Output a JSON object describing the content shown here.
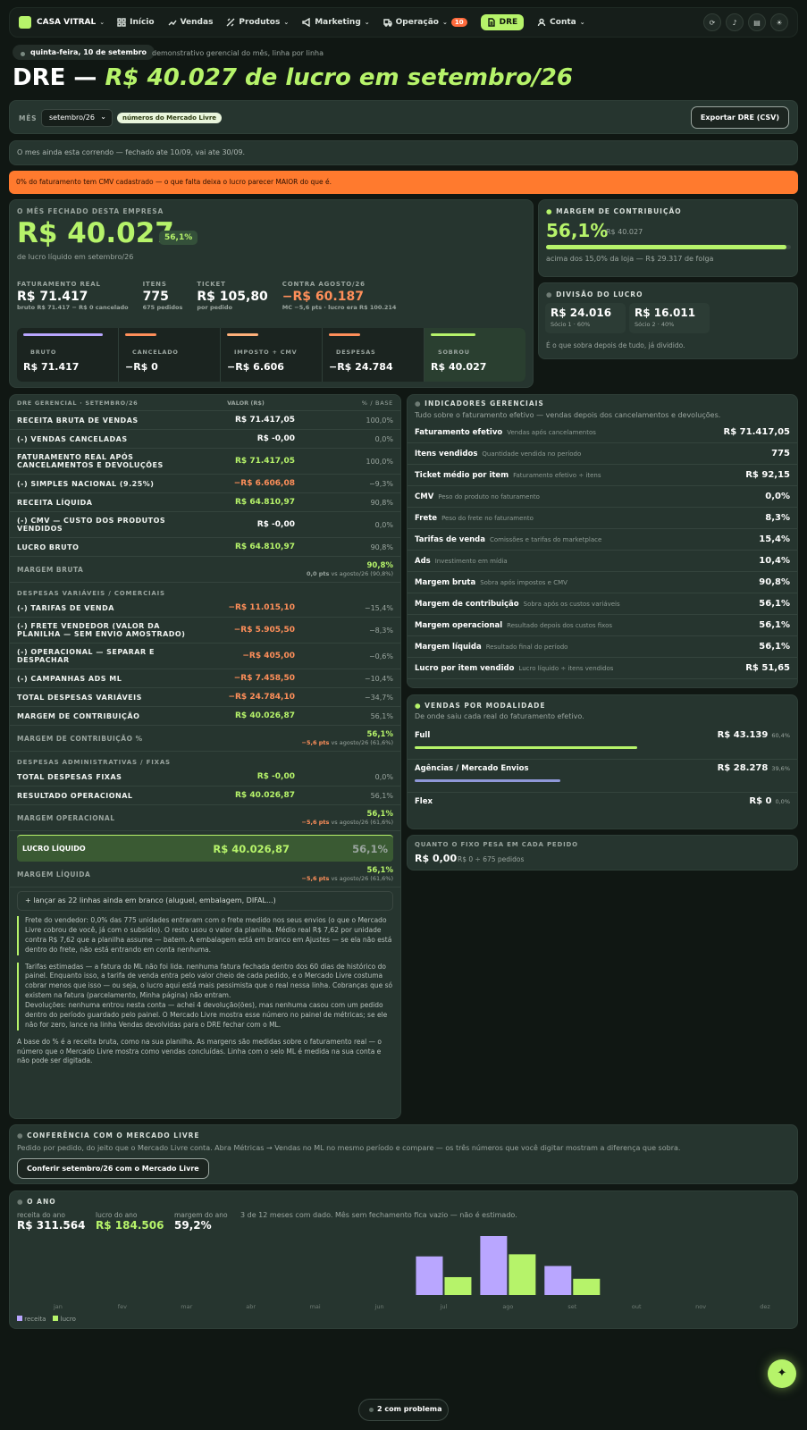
{
  "nav": {
    "brand": "CASA VITRAL",
    "items": [
      {
        "label": "Início",
        "icon": "home-icon"
      },
      {
        "label": "Vendas",
        "icon": "trend-icon"
      },
      {
        "label": "Produtos",
        "icon": "tag-icon"
      },
      {
        "label": "Marketing",
        "icon": "megaphone-icon"
      },
      {
        "label": "Operação",
        "icon": "truck-icon",
        "badge": "10"
      },
      {
        "label": "DRE",
        "icon": "document-icon"
      },
      {
        "label": "Conta",
        "icon": "user-icon"
      }
    ]
  },
  "header": {
    "date": "quinta-feira, 10 de setembro",
    "subtitle": "demonstrativo gerencial do mês, linha por linha",
    "title_a": "DRE —",
    "title_b": "R$ 40.027 de lucro em setembro/26"
  },
  "filter": {
    "label": "MÊS",
    "month": "setembro/26",
    "tag": "números do Mercado Livre",
    "export": "Exportar DRE (CSV)"
  },
  "info": "O mes ainda esta correndo — fechado ate 10/09, vai ate 30/09.",
  "warning": "0% do faturamento tem CMV cadastrado — o que falta deixa o lucro parecer MAIOR do que é.",
  "summary": {
    "label": "O MÊS FECHADO DESTA EMPRESA",
    "value": "R$ 40.027",
    "margin": "56,1%",
    "caption": "de lucro líquido em setembro/26",
    "kpis": [
      {
        "l": "FATURAMENTO REAL",
        "v": "R$ 71.417",
        "s": "bruto R$ 71.417 − R$ 0 cancelado"
      },
      {
        "l": "ITENS",
        "v": "775",
        "s": "675 pedidos"
      },
      {
        "l": "TICKET",
        "v": "R$ 105,80",
        "s": "por pedido"
      },
      {
        "l": "CONTRA AGOSTO/26",
        "v": "−R$ 60.187",
        "s": "MC −5,6 pts · lucro era R$ 100.214"
      }
    ],
    "flow": [
      {
        "l": "BRUTO",
        "v": "R$ 71.417"
      },
      {
        "l": "CANCELADO",
        "v": "−R$ 0"
      },
      {
        "l": "IMPOSTO + CMV",
        "v": "−R$ 6.606"
      },
      {
        "l": "DESPESAS",
        "v": "−R$ 24.784"
      },
      {
        "l": "SOBROU",
        "v": "R$ 40.027"
      }
    ]
  },
  "mc": {
    "label": "MARGEM DE CONTRIBUIÇÃO",
    "value": "56,1%",
    "abs": "R$ 40.027",
    "bar": 0.98,
    "note": "acima dos 15,0% da loja — R$ 29.317 de folga"
  },
  "div": {
    "label": "DIVISÃO DO LUCRO",
    "a": "R$ 24.016",
    "as": "Sócio 1 · 60%",
    "b": "R$ 16.011",
    "bs": "Sócio 2 · 40%",
    "note": "É o que sobra depois de tudo, já dividido."
  },
  "dre": {
    "head": [
      "DRE GERENCIAL · SETEMBRO/26",
      "VALOR (R$)",
      "% / BASE"
    ],
    "a": [
      {
        "n": "RECEITA BRUTA DE VENDAS",
        "ml": true,
        "v": "R$ 71.417,05",
        "p": "100,0%",
        "c": "white"
      },
      {
        "n": "(-) VENDAS CANCELADAS",
        "ml": true,
        "v": "R$ -0,00",
        "p": "0,0%",
        "c": "white"
      },
      {
        "n": "FATURAMENTO REAL APÓS CANCELAMENTOS E DEVOLUÇÕES",
        "v": "R$ 71.417,05",
        "p": "100,0%",
        "c": "green"
      },
      {
        "n": "(-) SIMPLES NACIONAL (9.25%)",
        "ml": true,
        "v": "−R$ 6.606,08",
        "p": "−9,3%",
        "c": "orange"
      },
      {
        "n": "RECEITA LÍQUIDA",
        "v": "R$ 64.810,97",
        "p": "90,8%",
        "c": "green"
      },
      {
        "n": "(-) CMV — CUSTO DOS PRODUTOS VENDIDOS",
        "ml": true,
        "v": "R$ -0,00",
        "p": "0,0%",
        "c": "white"
      },
      {
        "n": "LUCRO BRUTO",
        "v": "R$ 64.810,97",
        "p": "90,8%",
        "c": "green"
      }
    ],
    "mb": {
      "n": "MARGEM BRUTA",
      "v": "90,8%",
      "d": "0,0 pts",
      "r": "vs agosto/26 (90,8%)"
    },
    "sec_var": "DESPESAS VARIÁVEIS / COMERCIAIS",
    "b": [
      {
        "n": "(-) TARIFAS DE VENDA",
        "ml": true,
        "v": "−R$ 11.015,10",
        "p": "−15,4%",
        "c": "orange"
      },
      {
        "n": "(-) FRETE VENDEDOR (VALOR DA PLANILHA — SEM ENVIO AMOSTRADO)",
        "ml": true,
        "v": "−R$ 5.905,50",
        "p": "−8,3%",
        "c": "orange"
      },
      {
        "n": "(-) OPERACIONAL — SEPARAR E DESPACHAR",
        "ml": true,
        "v": "−R$ 405,00",
        "p": "−0,6%",
        "c": "orange"
      },
      {
        "n": "(-) CAMPANHAS ADS ML",
        "ml": true,
        "v": "−R$ 7.458,50",
        "p": "−10,4%",
        "c": "orange"
      },
      {
        "n": "TOTAL DESPESAS VARIÁVEIS",
        "v": "−R$ 24.784,10",
        "p": "−34,7%",
        "c": "orange"
      },
      {
        "n": "MARGEM DE CONTRIBUIÇÃO",
        "v": "R$ 40.026,87",
        "p": "56,1%",
        "c": "green"
      }
    ],
    "mcp": {
      "n": "MARGEM DE CONTRIBUIÇÃO %",
      "v": "56,1%",
      "d": "−5,6 pts",
      "r": "vs agosto/26 (61,6%)"
    },
    "sec_fix": "DESPESAS ADMINISTRATIVAS / FIXAS",
    "c": [
      {
        "n": "TOTAL DESPESAS FIXAS",
        "v": "R$ -0,00",
        "p": "0,0%",
        "c": "green"
      },
      {
        "n": "RESULTADO OPERACIONAL",
        "v": "R$ 40.026,87",
        "p": "56,1%",
        "c": "green"
      }
    ],
    "mo": {
      "n": "MARGEM OPERACIONAL",
      "v": "56,1%",
      "d": "−5,6 pts",
      "r": "vs agosto/26 (61,6%)"
    },
    "ll": {
      "n": "LUCRO LÍQUIDO",
      "v": "R$ 40.026,87",
      "p": "56,1%"
    },
    "ml": {
      "n": "MARGEM LÍQUIDA",
      "v": "56,1%",
      "d": "−5,6 pts",
      "r": "vs agosto/26 (61,6%)"
    },
    "launch": "+ lançar as 22 linhas ainda em branco (aluguel, embalagem, DIFAL...)",
    "note1": "Frete do vendedor: 0,0% das 775 unidades entraram com o frete medido nos seus envios (o que o Mercado Livre cobrou de você, já com o subsídio). O resto usou o valor da planilha. Médio real R$ 7,62 por unidade contra R$ 7,62 que a planilha assume — batem. A embalagem está em branco em Ajustes — se ela não está dentro do frete, não está entrando em conta nenhuma.",
    "note2": "Tarifas estimadas — a fatura do ML não foi lida. nenhuma fatura fechada dentro dos 60 dias de histórico do painel. Enquanto isso, a tarifa de venda entra pelo valor cheio de cada pedido, e o Mercado Livre costuma cobrar menos que isso — ou seja, o lucro aqui está mais pessimista que o real nessa linha. Cobranças que só existem na fatura (parcelamento, Minha página) não entram.",
    "note3": "Devoluções: nenhuma entrou nesta conta — achei 4 devolução(ões), mas nenhuma casou com um pedido dentro do período guardado pelo painel. O Mercado Livre mostra esse número no painel de métricas; se ele não for zero, lance na linha Vendas devolvidas para o DRE fechar com o ML.",
    "note4": "A base do % é a receita bruta, como na sua planilha. As margens são medidas sobre o faturamento real — o número que o Mercado Livre mostra como vendas concluídas. Linha com o selo ML é medida na sua conta e não pode ser digitada."
  },
  "ind": {
    "label": "INDICADORES GERENCIAIS",
    "sub": "Tudo sobre o faturamento efetivo — vendas depois dos cancelamentos e devoluções.",
    "rows": [
      {
        "n": "Faturamento efetivo",
        "d": "Vendas após cancelamentos",
        "v": "R$ 71.417,05"
      },
      {
        "n": "Itens vendidos",
        "d": "Quantidade vendida no período",
        "v": "775"
      },
      {
        "n": "Ticket médio por item",
        "d": "Faturamento efetivo ÷ itens",
        "v": "R$ 92,15"
      },
      {
        "n": "CMV",
        "d": "Peso do produto no faturamento",
        "v": "0,0%"
      },
      {
        "n": "Frete",
        "d": "Peso do frete no faturamento",
        "v": "8,3%"
      },
      {
        "n": "Tarifas de venda",
        "d": "Comissões e tarifas do marketplace",
        "v": "15,4%"
      },
      {
        "n": "Ads",
        "d": "Investimento em mídia",
        "v": "10,4%"
      },
      {
        "n": "Margem bruta",
        "d": "Sobra após impostos e CMV",
        "v": "90,8%"
      },
      {
        "n": "Margem de contribuição",
        "d": "Sobra após os custos variáveis",
        "v": "56,1%"
      },
      {
        "n": "Margem operacional",
        "d": "Resultado depois dos custos fixos",
        "v": "56,1%"
      },
      {
        "n": "Margem líquida",
        "d": "Resultado final do período",
        "v": "56,1%"
      },
      {
        "n": "Lucro por item vendido",
        "d": "Lucro líquido ÷ itens vendidos",
        "v": "R$ 51,65"
      }
    ]
  },
  "mod": {
    "label": "VENDAS POR MODALIDADE",
    "sub": "De onde saiu cada real do faturamento efetivo.",
    "rows": [
      {
        "n": "Full",
        "v": "R$ 43.139",
        "p": "60,4%",
        "f": 0.604,
        "c": "#b6f36a"
      },
      {
        "n": "Agências / Mercado Envios",
        "v": "R$ 28.278",
        "p": "39,6%",
        "f": 0.396,
        "c": "#8f98d8"
      },
      {
        "n": "Flex",
        "v": "R$ 0",
        "p": "0,0%",
        "f": 0,
        "c": "#b6f36a"
      }
    ]
  },
  "fixo": {
    "label": "QUANTO O FIXO PESA EM CADA PEDIDO",
    "v": "R$ 0,00",
    "s": "R$ 0 ÷ 675 pedidos"
  },
  "conf": {
    "label": "CONFERÊNCIA COM O MERCADO LIVRE",
    "text": "Pedido por pedido, do jeito que o Mercado Livre conta. Abra Métricas → Vendas no ML no mesmo período e compare — os três números que você digitar mostram a diferença que sobra.",
    "btn": "Conferir setembro/26 com o Mercado Livre"
  },
  "year": {
    "label": "O ANO",
    "k": [
      {
        "l": "receita do ano",
        "v": "R$ 311.564"
      },
      {
        "l": "lucro do ano",
        "v": "R$ 184.506"
      },
      {
        "l": "margem do ano",
        "v": "59,2%"
      }
    ],
    "note": "3 de 12 meses com dado. Mês sem fechamento fica vazio — não é estimado.",
    "legend": [
      "receita",
      "lucro"
    ]
  },
  "chart_data": {
    "type": "bar",
    "categories": [
      "jan",
      "fev",
      "mar",
      "abr",
      "mai",
      "jun",
      "jul",
      "ago",
      "set",
      "out",
      "nov",
      "dez"
    ],
    "series": [
      {
        "name": "receita",
        "values": [
          null,
          null,
          null,
          null,
          null,
          null,
          95000,
          145000,
          71417,
          null,
          null,
          null
        ]
      },
      {
        "name": "lucro",
        "values": [
          null,
          null,
          null,
          null,
          null,
          null,
          44000,
          100214,
          40027,
          null,
          null,
          null
        ]
      }
    ],
    "colors": [
      "#b9a6ff",
      "#b6f36a"
    ]
  },
  "fab": "✦",
  "problems": "2 com problema"
}
